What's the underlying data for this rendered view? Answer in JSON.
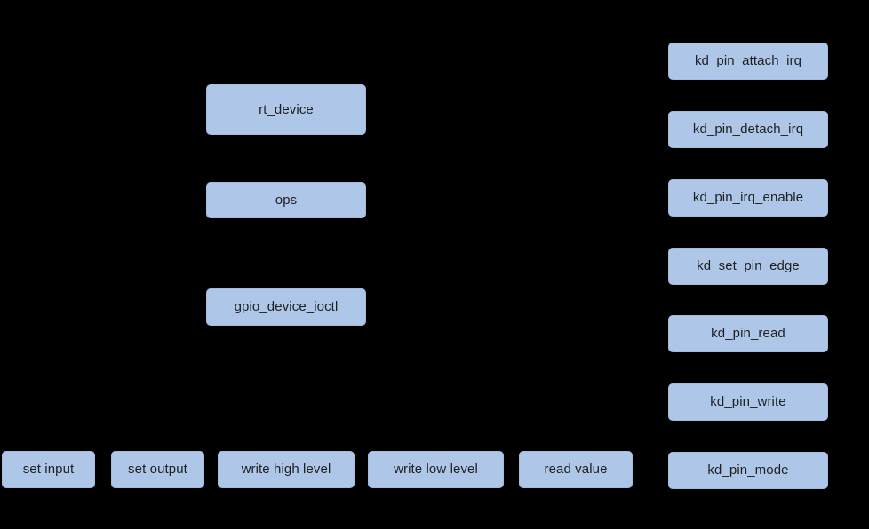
{
  "diagram": {
    "background_color": "#000000",
    "node_fill_color": "#aec7e8",
    "node_text_color": "#1f1f1f",
    "stack_column": [
      {
        "id": "rt_device",
        "label": "rt_device"
      },
      {
        "id": "ops",
        "label": "ops"
      },
      {
        "id": "gpio_device_ioctl",
        "label": "gpio_device_ioctl"
      }
    ],
    "driver_api_column": [
      {
        "id": "kd_pin_attach_irq",
        "label": "kd_pin_attach_irq"
      },
      {
        "id": "kd_pin_detach_irq",
        "label": "kd_pin_detach_irq"
      },
      {
        "id": "kd_pin_irq_enable",
        "label": "kd_pin_irq_enable"
      },
      {
        "id": "kd_set_pin_edge",
        "label": "kd_set_pin_edge"
      },
      {
        "id": "kd_pin_read",
        "label": "kd_pin_read"
      },
      {
        "id": "kd_pin_write",
        "label": "kd_pin_write"
      },
      {
        "id": "kd_pin_mode",
        "label": "kd_pin_mode"
      }
    ],
    "operation_row": [
      {
        "id": "set_input",
        "label": "set input"
      },
      {
        "id": "set_output",
        "label": "set output"
      },
      {
        "id": "write_high_level",
        "label": "write high level"
      },
      {
        "id": "write_low_level",
        "label": "write low level"
      },
      {
        "id": "read_value",
        "label": "read value"
      }
    ]
  }
}
